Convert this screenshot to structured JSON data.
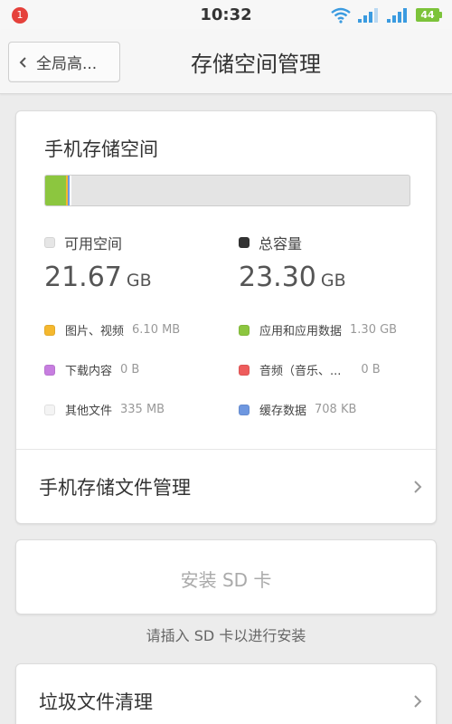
{
  "status_bar": {
    "notification_count": "1",
    "time": "10:32",
    "battery": "44",
    "icons": [
      "wifi-icon",
      "signal-icon",
      "signal-icon",
      "battery-icon"
    ]
  },
  "title_bar": {
    "back_label": "全局高...",
    "title": "存储空间管理"
  },
  "storage": {
    "title": "手机存储空间",
    "usage_bar": {
      "segments": [
        {
          "name": "应用和应用数据",
          "color": "#8cc63f",
          "fraction": 0.056
        },
        {
          "name": "图片、视频",
          "color": "#f5b82e",
          "fraction": 0.004
        },
        {
          "name": "缓存数据",
          "color": "#6e97e0",
          "fraction": 0.004
        },
        {
          "name": "其他文件",
          "color": "#ffffff",
          "fraction": 0.006
        }
      ],
      "track_color": "#e4e4e4"
    },
    "available": {
      "label": "可用空间",
      "value": "21.67",
      "unit": "GB",
      "color": "#e6e6e6"
    },
    "total": {
      "label": "总容量",
      "value": "23.30",
      "unit": "GB",
      "color": "#333333"
    },
    "legend": [
      {
        "name": "图片、视频",
        "size": "6.10 MB",
        "color": "#f5b82e"
      },
      {
        "name": "应用和应用数据",
        "size": "1.30 GB",
        "color": "#8cc63f"
      },
      {
        "name": "下载内容",
        "size": "0 B",
        "color": "#c77ee0"
      },
      {
        "name": "音频（音乐、...",
        "size": "0 B",
        "color": "#ee5c5c"
      },
      {
        "name": "其他文件",
        "size": "335 MB",
        "color": "#f4f4f4"
      },
      {
        "name": "缓存数据",
        "size": "708 KB",
        "color": "#6e97e0"
      }
    ],
    "manage_label": "手机存储文件管理"
  },
  "sd": {
    "install_label": "安装 SD 卡",
    "hint": "请插入 SD 卡以进行安装"
  },
  "junk": {
    "label": "垃圾文件清理"
  }
}
